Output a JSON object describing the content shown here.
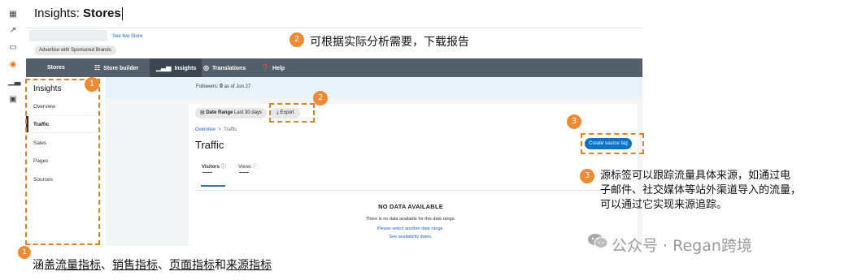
{
  "page": {
    "title_prefix": "Insights:",
    "title_store": "Stores"
  },
  "rail": {
    "icons": [
      "grid-icon",
      "trend-icon",
      "card-icon",
      "shield-icon",
      "bar-chart-icon",
      "image-gallery-icon"
    ]
  },
  "header": {
    "see_live": "See live Store",
    "advertise_label": "Advertise with Sponsored Brands"
  },
  "nav": {
    "items": [
      {
        "label": "Stores",
        "icon": ""
      },
      {
        "label": "Store builder",
        "icon": "sitemap-icon"
      },
      {
        "label": "Insights",
        "icon": "bar-chart-icon",
        "active": true
      },
      {
        "label": "Translations",
        "icon": "globe-icon"
      },
      {
        "label": "Help",
        "icon": "help-icon"
      }
    ]
  },
  "followers": {
    "label": "Followers:",
    "count": "0",
    "suffix": "as of Jun 27"
  },
  "sidebar": {
    "title": "Insights",
    "items": [
      "Overview",
      "Traffic",
      "Sales",
      "Pages",
      "Sources"
    ],
    "active": "Traffic"
  },
  "toolbar": {
    "date_range_label": "Date Range",
    "date_range_value": "Last 30 days",
    "export_label": "Export"
  },
  "breadcrumb": {
    "root": "Overview",
    "sep": ">",
    "current": "Traffic"
  },
  "main": {
    "title": "Traffic",
    "create_button": "Create source tag",
    "tabs": [
      {
        "label": "Visitors",
        "value": "—"
      },
      {
        "label": "Views",
        "value": "—"
      }
    ]
  },
  "empty": {
    "title": "NO DATA AVAILABLE",
    "text": "There is no data available for this date range.",
    "link1": "Please select another date range.",
    "link2": "See availability dates."
  },
  "annotations": {
    "badge1": "1",
    "badge2": "2",
    "badge3": "3",
    "top_note": "可根据实际分析需要，下载报告",
    "right_note_l1": "源标签可以跟踪流量具体来源，如通过电",
    "right_note_l2": "子邮件、社交媒体等站外渠道导入的流量，",
    "right_note_l3": "可以通过它实现来源追踪。",
    "bottom_prefix": "涵盖",
    "bottom_parts": [
      "流量指标",
      "销售指标",
      "页面指标",
      "来源指标"
    ],
    "bottom_seps": [
      "、",
      "、",
      "和"
    ]
  },
  "watermark": {
    "text": "公众号 · Regan跨境"
  },
  "colors": {
    "accent_orange": "#ec8b34",
    "nav_bg": "#545f6c",
    "primary_blue": "#0b72c4"
  }
}
